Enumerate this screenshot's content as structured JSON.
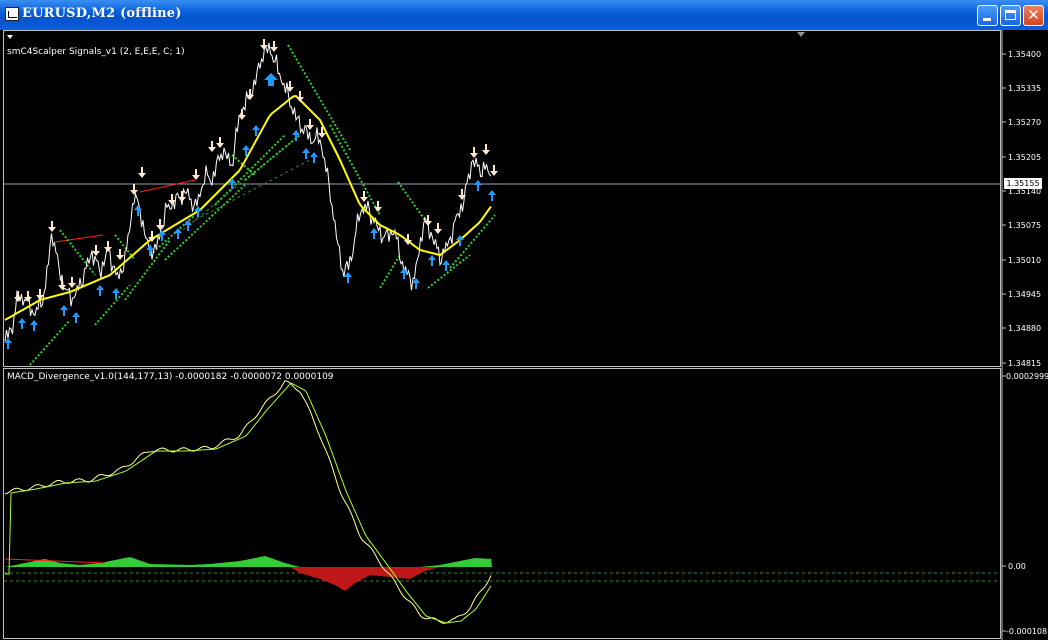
{
  "window": {
    "title": "EURUSD,M2 (offline)",
    "buttons": {
      "close_glyph": "✕"
    }
  },
  "main_chart": {
    "indicator_label": "smC4Scalper Signals_v1 (2, E,E,E, C; 1)",
    "price_scale": [
      "1.35400",
      "1.35335",
      "1.35270",
      "1.35205",
      "1.35140",
      "1.35075",
      "1.35010",
      "1.34945",
      "1.34880",
      "1.34815"
    ],
    "current_price": "1.35155",
    "colors": {
      "price": "#ffffff",
      "ma": "#ffff00",
      "band": "#32cd32",
      "buy_arrow": "#1e9bff",
      "sell_arrow": "#ffe8cc",
      "divergence": "#ff2020"
    }
  },
  "sub_chart": {
    "indicator_label": "MACD_Divergence_v1.0(144,177,13) -0.0000182 -0.0000072 0.0000109",
    "scale": [
      "0.0002999",
      "0.00",
      "-0.000108"
    ],
    "colors": {
      "macd": "#ffff99",
      "signal": "#adff2f",
      "hist_pos": "#32cd32",
      "hist_neg": "#c01818"
    }
  }
}
